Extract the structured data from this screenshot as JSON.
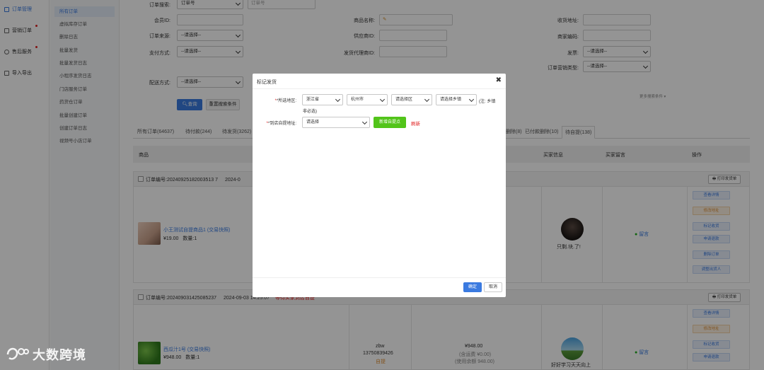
{
  "sidebar": {
    "items": [
      {
        "label": "订单管理",
        "icon": "order-icon",
        "active": true
      },
      {
        "label": "营销订单",
        "icon": "marketing-icon",
        "dot": true
      },
      {
        "label": "售后服务",
        "icon": "service-icon",
        "dot": true
      },
      {
        "label": "导入导出",
        "icon": "import-icon"
      }
    ]
  },
  "subnav": {
    "items": [
      "所有订单",
      "虚拟库存订单",
      "删除日志",
      "批量发货",
      "批量发货日志",
      "小程序发货日志",
      "门店服务订单",
      "药货仓订单",
      "批量创建订单",
      "创建订单日志",
      "视频号小店订单"
    ]
  },
  "search": {
    "order_search_label": "订单搜索:",
    "order_search_type": "订单号",
    "order_search_placeholder": "订单号",
    "member_id_label": "会员ID:",
    "order_source_label": "订单来源:",
    "order_source_value": "--请选择--",
    "pay_method_label": "支付方式:",
    "pay_method_value": "--请选择--",
    "delivery_method_label": "配送方式:",
    "delivery_method_value": "--请选择--",
    "product_name_label": "商品名称:",
    "supplier_id_label": "供应商ID:",
    "agent_id_label": "发货代理商ID:",
    "receive_addr_label": "收货地址:",
    "merchant_code_label": "商家编码:",
    "shipping_label": "发票:",
    "shipping_value": "--请选择--",
    "marketing_type_label": "订单营销类型:",
    "marketing_type_value": "--请选择--",
    "query_button": "查询",
    "reset_button": "重置搜索条件",
    "more_conditions": "更多搜索条件"
  },
  "tabs": {
    "all": "所有订单(64637)",
    "pending_pay": "待付款(244)",
    "pending_ship": "待发货(3262)",
    "deleted": "已删除(8)",
    "paid_deleted": "已付款删除(10)",
    "pending_pickup": "待自提(138)"
  },
  "table": {
    "headers": {
      "product": "商品",
      "buyer": "买家信息",
      "message": "买家留言",
      "action": "操作"
    }
  },
  "orders": [
    {
      "order_no_label": "订单编号:",
      "order_no": "20240925182003513 7",
      "date": "2024-0",
      "print_button": "打印发货单",
      "product_name": "小王测试自提商品1 (交易快照)",
      "price": "¥19.00",
      "qty_label": "数量:",
      "qty": "1",
      "buyer_name": "只剩.块.了!",
      "message_icon": "wechat-icon",
      "message_label": "留言",
      "actions": [
        "查看详情",
        "修改地址",
        "标记收货",
        "申请退款",
        "删除订单",
        "调整出货人"
      ]
    },
    {
      "order_no_label": "订单编号:",
      "order_no": "202409031425085237",
      "date": "2024-09-03 14:25:07",
      "tag": "等待买家到店自提",
      "print_button": "打印发货单",
      "product_name": "西瓜汁1号 (交易快照)",
      "price": "¥948.00",
      "qty_label": "数量:",
      "qty": "1",
      "receiver": "zbw",
      "phone": "13750839426",
      "pickup_tag": "自提",
      "total": "¥948.00",
      "shipping_fee": "(含运费 ¥0.00)",
      "points": "(使用余额 948.00)",
      "buyer_name": "好好学习天天向上",
      "message_label": "留言",
      "actions": [
        "查看详情",
        "修改地址",
        "标记收货",
        "申请退款"
      ]
    }
  ],
  "modal": {
    "title": "标记发货",
    "close": "✖",
    "region_label": "*所选地区:",
    "province": "浙江省",
    "city": "杭州市",
    "district": "请选择区",
    "street": "请选择乡镇",
    "note": "(注: 乡镇",
    "note2": "非必选)",
    "pickup_label": "*到店自提地址:",
    "pickup_value": "请选择",
    "add_pickup_button": "新增自提点",
    "refresh_link": "刷新",
    "confirm_button": "确定",
    "cancel_button": "取消"
  },
  "watermark": {
    "text": "大数跨境"
  }
}
